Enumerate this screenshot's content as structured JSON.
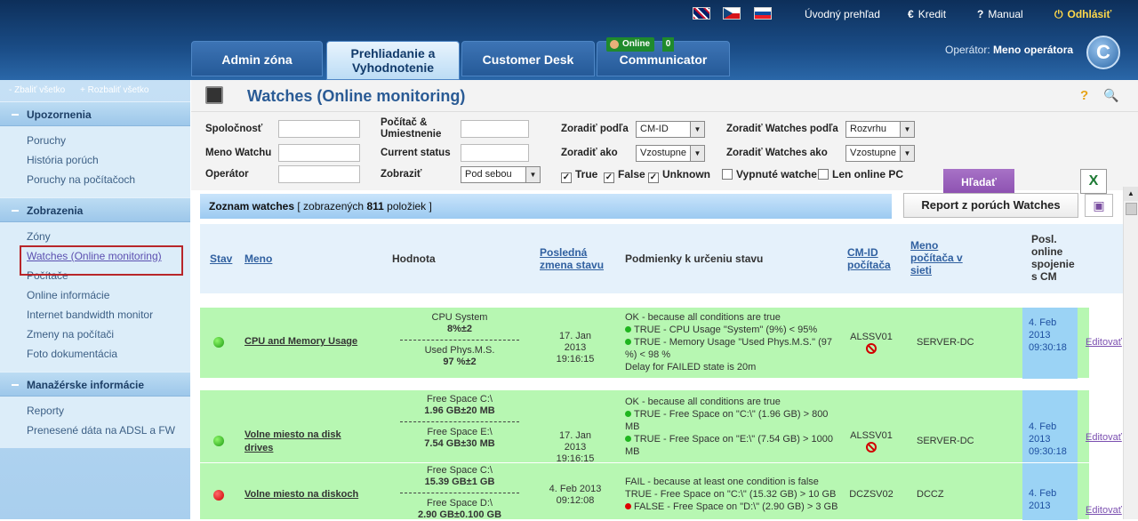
{
  "header": {
    "links": {
      "home": "Úvodný prehľad",
      "credit": "Kredit",
      "manual": "Manual",
      "logout": "Odhlásiť"
    },
    "tabs": {
      "admin": "Admin zóna",
      "browse_line1": "Prehliadanie a",
      "browse_line2": "Vyhodnotenie",
      "desk": "Customer Desk",
      "communicator": "Communicator"
    },
    "online_badge": "Online",
    "online_count": "0",
    "operator_label": "Operátor:",
    "operator_name": "Meno operátora",
    "colors": {
      "accent": "#2a5b95",
      "online": "#1f8a2c"
    }
  },
  "sidebar": {
    "collapse_all": "- Zbaliť všetko",
    "expand_all": "+ Rozbaliť všetko",
    "sections": [
      {
        "title": "Upozornenia",
        "items": [
          "Poruchy",
          "História porúch",
          "Poruchy na počítačoch"
        ]
      },
      {
        "title": "Zobrazenia",
        "items": [
          "Zóny",
          "Watches (Online monitoring)",
          "Počítače",
          "Online informácie",
          "Internet bandwidth monitor",
          "Zmeny na počítači",
          "Foto dokumentácia"
        ]
      },
      {
        "title": "Manažérske informácie",
        "items": [
          "Reporty",
          "Prenesené dáta na ADSL a FW"
        ]
      }
    ]
  },
  "page": {
    "title": "Watches (Online monitoring)",
    "filters": {
      "company": "Spoločnosť",
      "pc_location": "Počítač & Umiestnenie",
      "sort_by": "Zoradiť podľa",
      "sort_by_value": "CM-ID",
      "sort_watches_by": "Zoradiť Watches podľa",
      "sort_watches_by_value": "Rozvrhu",
      "watch_name": "Meno Watchu",
      "current_status": "Current status",
      "sort_as": "Zoradiť ako",
      "sort_as_value": "Vzostupne",
      "sort_watches_as": "Zoradiť Watches ako",
      "sort_watches_as_value": "Vzostupne",
      "operator": "Operátor",
      "display": "Zobraziť",
      "display_value": "Pod sebou",
      "cb_true": "True",
      "cb_false": "False",
      "cb_unknown": "Unknown",
      "cb_disabled": "Vypnuté watche",
      "cb_online": "Len online PC",
      "search": "Hľadať"
    },
    "list": {
      "title": "Zoznam watches",
      "shown_prefix": "[ zobrazených",
      "shown_count": "811",
      "shown_suffix": "položiek ]",
      "report_button": "Report z porúch Watches"
    },
    "columns": {
      "status": "Stav",
      "name": "Meno",
      "value": "Hodnota",
      "last_change_1": "Posledná",
      "last_change_2": "zmena stavu",
      "conditions": "Podmienky k určeniu stavu",
      "cmid_1": "CM-ID",
      "cmid_2": "počítača",
      "netname_1": "Meno",
      "netname_2": "počítača v",
      "netname_3": "sieti",
      "lastconn_1": "Posl.",
      "lastconn_2": "online",
      "lastconn_3": "spojenie",
      "lastconn_4": "s CM"
    },
    "rows": [
      {
        "status": "green",
        "name": "CPU and Memory Usage",
        "values": [
          {
            "label": "CPU System",
            "value": "8%±2"
          },
          {
            "label": "Used Phys.M.S.",
            "value": "97 %±2"
          }
        ],
        "changed_1": "17. Jan 2013",
        "changed_2": "19:16:15",
        "cond_head": "OK - because all conditions are true",
        "cond_1": "TRUE - CPU Usage \"System\" (9%) < 95%",
        "cond_2a": "TRUE - Memory Usage \"Used Phys.M.S.\" (97",
        "cond_2b": "%) < 98 %",
        "cond_3": "Delay for FAILED state is 20m",
        "cmid": "ALSSV01",
        "netname": "SERVER-DC",
        "conn_1": "4. Feb",
        "conn_2": "2013",
        "conn_3": "09:30:18",
        "edit": "Editovať"
      },
      {
        "status": "green",
        "name_1": "Volne miesto na disk",
        "name_2": "drives",
        "values": [
          {
            "label": "Free Space C:\\",
            "value": "1.96 GB±20 MB"
          },
          {
            "label": "Free Space E:\\",
            "value": "7.54 GB±30 MB"
          }
        ],
        "changed_1": "17. Jan 2013",
        "changed_2": "19:16:15",
        "cond_head": "OK - because all conditions are true",
        "cond_1a": "TRUE - Free Space on \"C:\\\" (1.96 GB) > 800",
        "cond_1b": "MB",
        "cond_2a": "TRUE - Free Space on \"E:\\\" (7.54 GB) > 1000",
        "cond_2b": "MB",
        "cmid": "ALSSV01",
        "netname": "SERVER-DC",
        "conn_1": "4. Feb",
        "conn_2": "2013",
        "conn_3": "09:30:18",
        "edit": "Editovať"
      },
      {
        "status": "red",
        "name": "Volne miesto na diskoch",
        "values": [
          {
            "label": "Free Space C:\\",
            "value": "15.39 GB±1 GB"
          },
          {
            "label": "Free Space D:\\",
            "value": "2.90 GB±0.100 GB"
          }
        ],
        "changed_1": "4. Feb 2013",
        "changed_2": "09:12:08",
        "cond_head": "FAIL - because at least one condition is false",
        "cond_1": "TRUE - Free Space on \"C:\\\" (15.32 GB) > 10 GB",
        "cond_2": "FALSE - Free Space on \"D:\\\" (2.90 GB) > 3 GB",
        "cmid": "DCZSV02",
        "netname": "DCCZ",
        "conn_1": "4. Feb",
        "conn_2": "2013",
        "edit": "Editovať"
      }
    ]
  }
}
